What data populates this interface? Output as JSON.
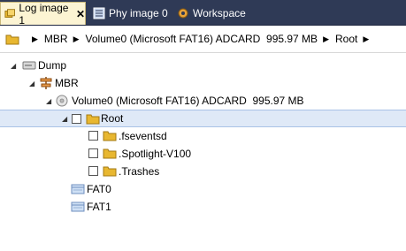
{
  "tabs": [
    {
      "label": "Log image 1",
      "icon": "log-image-icon",
      "close": "✕",
      "active": true
    },
    {
      "label": "Phy image 0",
      "icon": "phy-image-icon",
      "active": false
    },
    {
      "label": "Workspace",
      "icon": "gear-icon",
      "active": false
    }
  ],
  "breadcrumb": {
    "icon": "folder-icon",
    "items": [
      "MBR",
      "Volume0 (Microsoft FAT16) ADCARD  995.97 MB",
      "Root"
    ]
  },
  "tree": {
    "dump": "Dump",
    "mbr": "MBR",
    "volume": "Volume0 (Microsoft FAT16) ADCARD  995.97 MB",
    "root": "Root",
    "fseventsd": ".fseventsd",
    "spotlight": ".Spotlight-V100",
    "trashes": ".Trashes",
    "fat0": "FAT0",
    "fat1": "FAT1"
  },
  "colors": {
    "tabbar": "#2f3a56",
    "active_tab": "#fcf4d3",
    "selection": "#dfe9f7",
    "folder": "#e8b730"
  }
}
